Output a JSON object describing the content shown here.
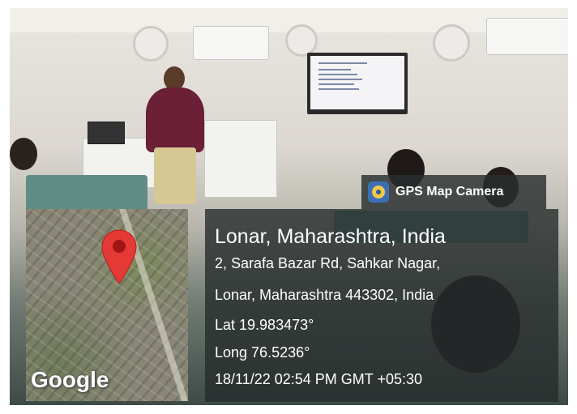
{
  "badge": {
    "label": "GPS Map Camera",
    "icon": "gps-map-camera-app-icon"
  },
  "map": {
    "watermark": "Google",
    "pin_icon": "location-pin-icon",
    "pin_color": "#e53935"
  },
  "location": {
    "title": "Lonar, Maharashtra, India",
    "address_line1": "2, Sarafa Bazar Rd, Sahkar Nagar,",
    "address_line2": "Lonar, Maharashtra 443302, India",
    "lat": "Lat 19.983473°",
    "long": "Long 76.5236°",
    "datetime": "18/11/22 02:54 PM GMT +05:30"
  },
  "colors": {
    "overlay": "#262c2c",
    "text": "#ffffff"
  }
}
